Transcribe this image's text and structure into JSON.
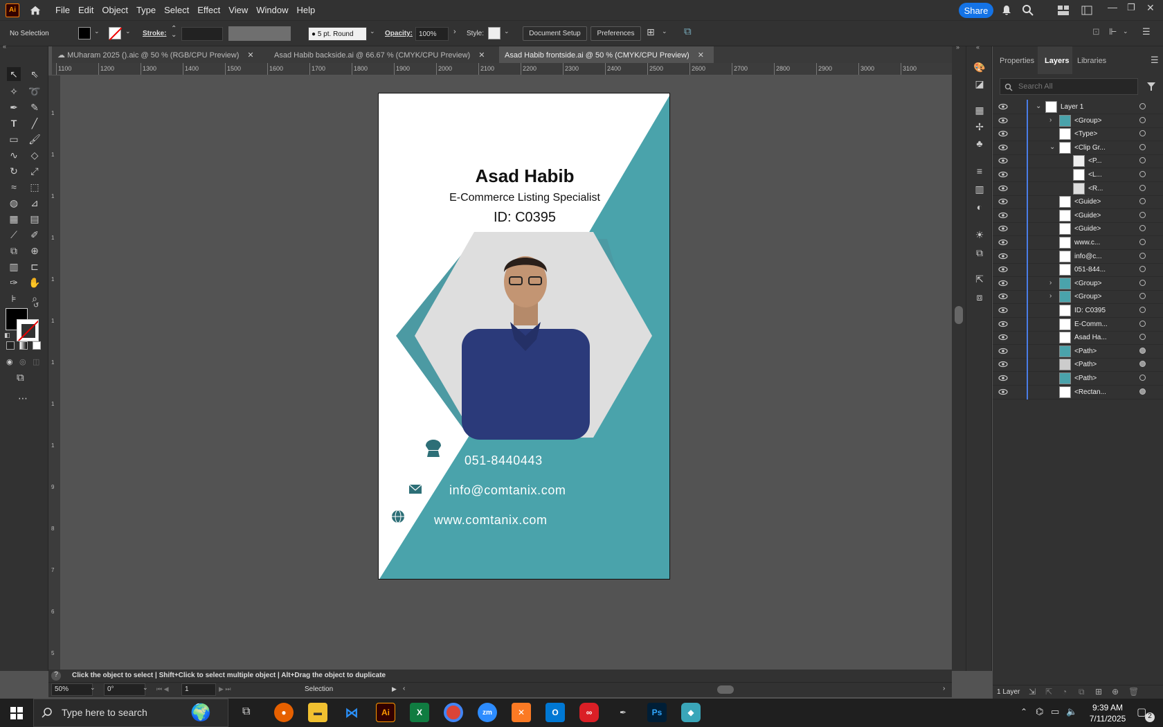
{
  "menubar": {
    "app_logo": "Ai",
    "items": [
      "File",
      "Edit",
      "Object",
      "Type",
      "Select",
      "Effect",
      "View",
      "Window",
      "Help"
    ],
    "share": "Share"
  },
  "control": {
    "selection": "No Selection",
    "stroke_label": "Stroke:",
    "brush": "5 pt. Round",
    "opacity_label": "Opacity:",
    "opacity": "100%",
    "style_label": "Style:",
    "doc_setup": "Document Setup",
    "preferences": "Preferences"
  },
  "tabs": [
    {
      "label": "MUharam 2025 ().aic @ 50 % (RGB/CPU Preview)"
    },
    {
      "label": "Asad Habib backside.ai @ 66.67 % (CMYK/CPU Preview)"
    },
    {
      "label": "Asad Habib frontside.ai @ 50 % (CMYK/CPU Preview)"
    }
  ],
  "ruler": {
    "h_labels": [
      "1100",
      "1200",
      "1300",
      "1400",
      "1500",
      "1600",
      "1700",
      "1800",
      "1900",
      "2000",
      "2100",
      "2200",
      "2300",
      "2400",
      "2500",
      "2600",
      "2700",
      "2800",
      "2900",
      "3000",
      "3100"
    ],
    "v_labels": [
      "1",
      "1",
      "1",
      "1",
      "1",
      "1",
      "1",
      "1",
      "1",
      "9",
      "8",
      "7",
      "6",
      "5"
    ]
  },
  "card": {
    "name": "Asad Habib",
    "role": "E-Commerce Listing Specialist",
    "id": "ID: C0395",
    "phone": "051-8440443",
    "email": "info@comtanix.com",
    "web": "www.comtanix.com",
    "teal": "#4aa3ab"
  },
  "panel": {
    "tabs": [
      "Properties",
      "Layers",
      "Libraries"
    ],
    "search_placeholder": "Search All",
    "layers": [
      {
        "name": "Layer 1",
        "indent": 0,
        "chev": "v",
        "circ": false
      },
      {
        "name": "<Group>",
        "indent": 1,
        "chev": ">",
        "circ": false
      },
      {
        "name": "<Type>",
        "indent": 1,
        "chev": "",
        "circ": false
      },
      {
        "name": "<Clip Gr...",
        "indent": 1,
        "chev": "v",
        "circ": false
      },
      {
        "name": "<P...",
        "indent": 2,
        "chev": "",
        "circ": false
      },
      {
        "name": "<L...",
        "indent": 2,
        "chev": "",
        "circ": false
      },
      {
        "name": "<R...",
        "indent": 2,
        "chev": "",
        "circ": false
      },
      {
        "name": "<Guide>",
        "indent": 1,
        "chev": "",
        "circ": false
      },
      {
        "name": "<Guide>",
        "indent": 1,
        "chev": "",
        "circ": false
      },
      {
        "name": "<Guide>",
        "indent": 1,
        "chev": "",
        "circ": false
      },
      {
        "name": "www.c...",
        "indent": 1,
        "chev": "",
        "circ": false
      },
      {
        "name": "info@c...",
        "indent": 1,
        "chev": "",
        "circ": false
      },
      {
        "name": "051-844...",
        "indent": 1,
        "chev": "",
        "circ": false
      },
      {
        "name": "<Group>",
        "indent": 1,
        "chev": ">",
        "circ": false
      },
      {
        "name": "<Group>",
        "indent": 1,
        "chev": ">",
        "circ": false
      },
      {
        "name": "ID: C0395",
        "indent": 1,
        "chev": "",
        "circ": false
      },
      {
        "name": "E-Comm...",
        "indent": 1,
        "chev": "",
        "circ": false
      },
      {
        "name": "Asad Ha...",
        "indent": 1,
        "chev": "",
        "circ": false
      },
      {
        "name": "<Path>",
        "indent": 1,
        "chev": "",
        "circ": true
      },
      {
        "name": "<Path>",
        "indent": 1,
        "chev": "",
        "circ": true
      },
      {
        "name": "<Path>",
        "indent": 1,
        "chev": "",
        "circ": false
      },
      {
        "name": "<Rectan...",
        "indent": 1,
        "chev": "",
        "circ": true
      }
    ],
    "footer": "1 Layer"
  },
  "status": {
    "hint": "Click the object to select  |  Shift+Click to select multiple object  |  Alt+Drag the object to duplicate",
    "zoom": "50%",
    "rotation": "0°",
    "artboard": "1",
    "tool": "Selection"
  },
  "taskbar": {
    "search": "Type here to search",
    "time": "9:39 AM",
    "date": "7/11/2025",
    "notif": "2"
  }
}
